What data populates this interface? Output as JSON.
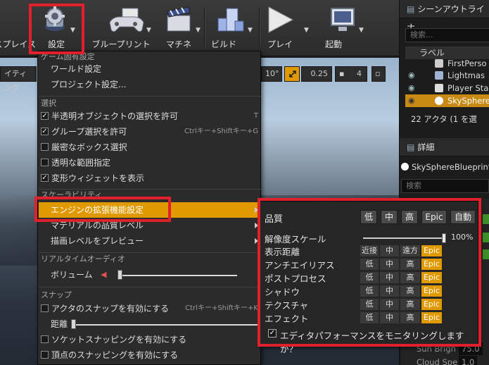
{
  "toolbar": {
    "buttons": [
      {
        "label": "ースプレイス",
        "icon": "place-icon"
      },
      {
        "label": "設定",
        "icon": "gear-icon"
      },
      {
        "label": "ブループリント",
        "icon": "gamepad-icon"
      },
      {
        "label": "マチネ",
        "icon": "clapper-icon"
      },
      {
        "label": "ビルド",
        "icon": "build-icon"
      },
      {
        "label": "プレイ",
        "icon": "play-icon"
      },
      {
        "label": "起動",
        "icon": "monitor-icon"
      }
    ]
  },
  "viewport": {
    "left_label": "イティング",
    "rotation_snap": "10°",
    "scale_snap": "0.25",
    "camera_speed": "4"
  },
  "menu": {
    "section_game": "ゲーム固有設定",
    "world_settings": "ワールド設定",
    "project_settings": "プロジェクト設定...",
    "section_select": "選択",
    "select_items": [
      {
        "label": "半透明オブジェクトの選択を許可",
        "checked": true,
        "shortcut": "T"
      },
      {
        "label": "グループ選択を許可",
        "checked": true,
        "shortcut": "Ctrlキー+Shiftキー+G"
      },
      {
        "label": "厳密なボックス選択",
        "checked": false,
        "shortcut": ""
      },
      {
        "label": "透明な範囲指定",
        "checked": false,
        "shortcut": ""
      },
      {
        "label": "変形ウィジェットを表示",
        "checked": true,
        "shortcut": ""
      }
    ],
    "section_scalability": "スケーラビリティ",
    "engine_scalability": "エンジンの拡張機能設定",
    "material_quality": "マテリアルの品質レベル",
    "preview_rendering": "描画レベルをプレビュー",
    "section_audio": "リアルタイムオーディオ",
    "volume": "ボリューム",
    "volume_level": 0.0,
    "section_snap": "スナップ",
    "snap_actor": "アクタのスナップを有効にする",
    "snap_actor_shortcut": "Ctrlキー+Shiftキー+K",
    "snap_distance": "距離",
    "snap_distance_level": 0.0,
    "socket_snap": "ソケットスナッピングを有効にする",
    "vertex_snap": "頂点のスナッピングを有効にする"
  },
  "quality_popup": {
    "title": "品質",
    "presets": [
      "低",
      "中",
      "高",
      "Epic",
      "自動"
    ],
    "resolution_scale_label": "解像度スケール",
    "resolution_scale_value": "100%",
    "resolution_scale_level": 1.0,
    "rows": [
      {
        "label": "表示距離",
        "options": [
          "近接",
          "中",
          "遠方",
          "Epic"
        ],
        "selected": 3
      },
      {
        "label": "アンチエイリアス",
        "options": [
          "低",
          "中",
          "高",
          "Epic"
        ],
        "selected": 3
      },
      {
        "label": "ポストプロセス",
        "options": [
          "低",
          "中",
          "高",
          "Epic"
        ],
        "selected": 3
      },
      {
        "label": "シャドウ",
        "options": [
          "低",
          "中",
          "高",
          "Epic"
        ],
        "selected": 3
      },
      {
        "label": "テクスチャ",
        "options": [
          "低",
          "中",
          "高",
          "Epic"
        ],
        "selected": 3
      },
      {
        "label": "エフェクト",
        "options": [
          "低",
          "中",
          "高",
          "Epic"
        ],
        "selected": 3
      }
    ],
    "monitor_label": "エディタパフォーマンスをモニタリングしますか？",
    "monitor_checked": true
  },
  "outliner": {
    "tab_title": "シーンアウトライナ",
    "search_placeholder": "検索...",
    "column_label": "ラベル",
    "items": [
      "FirstPerso",
      "Lightmas",
      "Player Sta",
      "SkySphere"
    ],
    "selected_index": 3,
    "actor_count": "22 アクタ (1 を選"
  },
  "details": {
    "tab_title": "詳細",
    "object_name": "SkySphereBlueprint",
    "search_placeholder": "検索",
    "prop_1": "Sun Brigh",
    "prop_1_value": "75.0",
    "prop_2": "Cloud Spe",
    "prop_2_value": "1.0"
  },
  "colors": {
    "highlight": "#e09a00",
    "annotation_red": "#e0202a"
  }
}
